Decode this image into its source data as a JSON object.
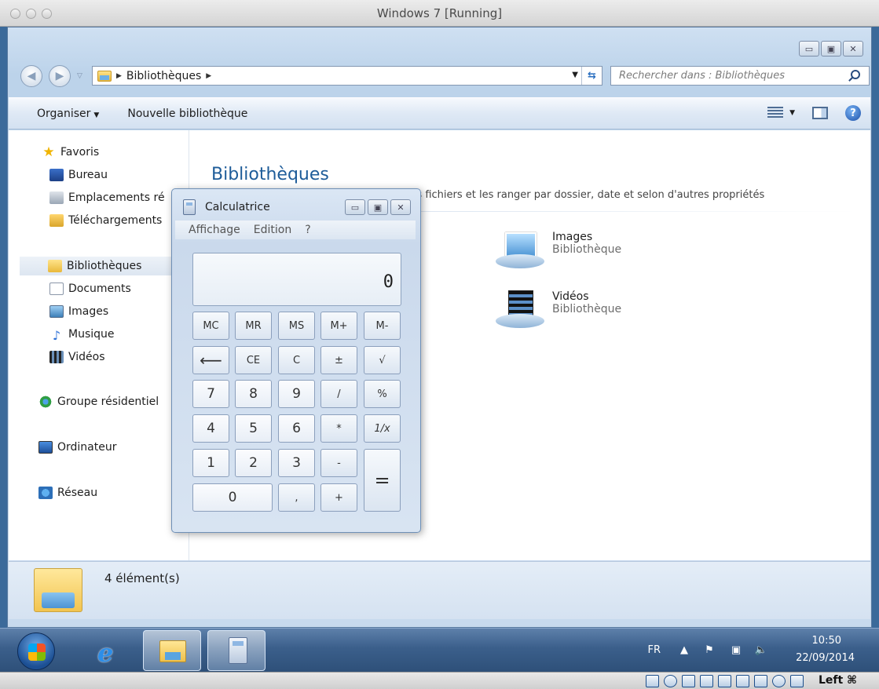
{
  "vm": {
    "title": "Windows 7 [Running]",
    "host_key": "Left ⌘"
  },
  "explorer": {
    "breadcrumb": "Bibliothèques",
    "search_placeholder": "Rechercher dans : Bibliothèques",
    "toolbar": {
      "organize": "Organiser",
      "new_library": "Nouvelle bibliothèque"
    },
    "nav": {
      "favorites": "Favoris",
      "desktop": "Bureau",
      "recent_places": "Emplacements ré",
      "downloads": "Téléchargements",
      "libraries": "Bibliothèques",
      "documents": "Documents",
      "images": "Images",
      "music": "Musique",
      "videos": "Vidéos",
      "homegroup": "Groupe résidentiel",
      "computer": "Ordinateur",
      "network": "Réseau"
    },
    "main": {
      "title": "Bibliothèques",
      "subtitle": "Ouvrir une bibliothèque pour afficher vos fichiers et les ranger par dossier, date et selon d'autres propriétés",
      "libraries": [
        {
          "name": "Images",
          "type": "Bibliothèque"
        },
        {
          "name": "Vidéos",
          "type": "Bibliothèque"
        }
      ]
    },
    "status": "4 élément(s)"
  },
  "calculator": {
    "title": "Calculatrice",
    "menu": [
      "Affichage",
      "Edition",
      "?"
    ],
    "display": "0",
    "keys": {
      "mc": "MC",
      "mr": "MR",
      "ms": "MS",
      "mplus": "M+",
      "mminus": "M-",
      "back": "⟵",
      "ce": "CE",
      "c": "C",
      "sign": "±",
      "sqrt": "√",
      "k7": "7",
      "k8": "8",
      "k9": "9",
      "div": "/",
      "pct": "%",
      "k4": "4",
      "k5": "5",
      "k6": "6",
      "mul": "*",
      "inv": "1/x",
      "k1": "1",
      "k2": "2",
      "k3": "3",
      "sub": "-",
      "eq": "=",
      "k0": "0",
      "dot": ",",
      "add": "+"
    }
  },
  "taskbar": {
    "language": "FR",
    "time": "10:50",
    "date": "22/09/2014"
  }
}
